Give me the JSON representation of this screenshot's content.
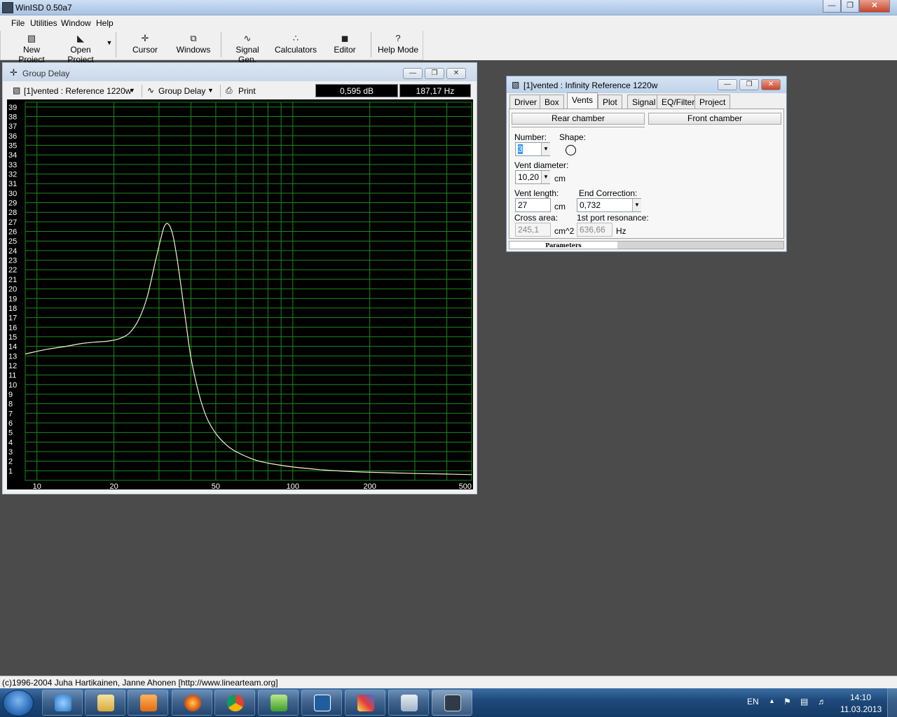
{
  "app": {
    "title": "WinISD 0.50a7"
  },
  "menu": [
    "File",
    "Utilities",
    "Window",
    "Help"
  ],
  "toolbar": {
    "new_project": "New Project",
    "open_project": "Open Project",
    "cursor": "Cursor",
    "windows": "Windows",
    "signal_gen": "Signal Gen.",
    "calculators": "Calculators",
    "editor": "Editor",
    "help_mode": "Help Mode"
  },
  "graph_window": {
    "title": "Group Delay",
    "project_select": "[1]vented : Reference 1220w",
    "graph_select": "Group Delay",
    "print_label": "Print",
    "readout_db": "0,595 dB",
    "readout_hz": "187,17 Hz"
  },
  "chart_data": {
    "type": "line",
    "title": "",
    "xlabel": "",
    "ylabel": "",
    "x_scale": "log",
    "xlim": [
      9,
      500
    ],
    "ylim": [
      0,
      39.5
    ],
    "x_tick_labels": [
      "10",
      "20",
      "50",
      "100",
      "200",
      "500"
    ],
    "x_tick_values": [
      10,
      20,
      50,
      100,
      200,
      500
    ],
    "y_tick_labels": [
      "1",
      "2",
      "3",
      "4",
      "5",
      "6",
      "7",
      "8",
      "9",
      "10",
      "11",
      "12",
      "13",
      "14",
      "15",
      "16",
      "17",
      "18",
      "19",
      "20",
      "21",
      "22",
      "23",
      "24",
      "25",
      "26",
      "27",
      "28",
      "29",
      "30",
      "31",
      "32",
      "33",
      "34",
      "35",
      "36",
      "37",
      "38",
      "39"
    ],
    "grid": true,
    "series": [
      {
        "x": [
          9,
          11,
          13,
          15,
          17,
          19,
          21,
          23,
          25,
          27,
          29,
          31,
          32,
          33,
          34,
          35,
          36,
          38,
          40,
          43,
          46,
          50,
          55,
          60,
          70,
          80,
          100,
          130,
          160,
          200,
          300,
          400,
          500
        ],
        "y": [
          13.2,
          13.7,
          14.0,
          14.3,
          14.45,
          14.55,
          14.8,
          15.4,
          16.8,
          19.2,
          22.8,
          26.0,
          26.8,
          26.6,
          25.6,
          23.8,
          21.6,
          17.0,
          12.8,
          9.0,
          6.6,
          4.9,
          3.7,
          3.0,
          2.2,
          1.8,
          1.4,
          1.1,
          0.95,
          0.85,
          0.72,
          0.66,
          0.6
        ]
      }
    ]
  },
  "vents_window": {
    "title": "[1]vented : Infinity Reference 1220w",
    "tabs": [
      "Driver",
      "Box",
      "Vents",
      "Plot",
      "Signal",
      "EQ/Filter",
      "Project"
    ],
    "rear_chamber": "Rear chamber",
    "front_chamber": "Front chamber",
    "number_label": "Number:",
    "number_value": "3",
    "shape_label": "Shape:",
    "vent_diameter_label": "Vent diameter:",
    "vent_diameter_value": "10,20",
    "vent_diameter_unit": "cm",
    "vent_length_label": "Vent length:",
    "vent_length_value": "27",
    "vent_length_unit": "cm",
    "end_correction_label": "End Correction:",
    "end_correction_value": "0,732",
    "cross_area_label": "Cross area:",
    "cross_area_value": "245,1",
    "cross_area_unit": "cm^2",
    "port_resonance_label": "1st port resonance:",
    "port_resonance_value": "636,66",
    "port_resonance_unit": "Hz",
    "parameters_label": "Parameters"
  },
  "status_bar": "(c)1996-2004 Juha Hartikainen, Janne Ahonen [http://www.linearteam.org]",
  "taskbar": {
    "lang": "EN",
    "time": "14:10",
    "date": "11.03.2013"
  }
}
